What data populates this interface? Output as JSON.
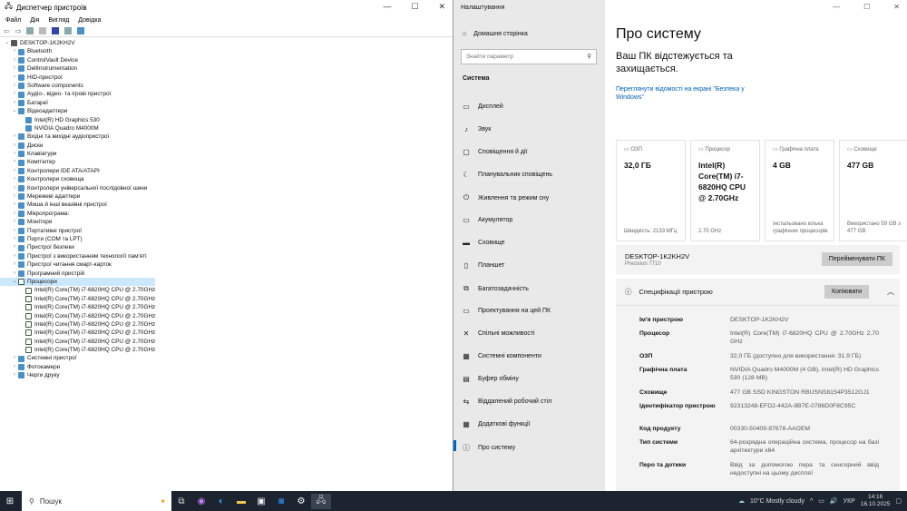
{
  "device_manager": {
    "title": "Диспетчер пристроїв",
    "menu": [
      "Файл",
      "Дія",
      "Вигляд",
      "Довідка"
    ],
    "root": "DESKTOP-1K2KH2V",
    "items": [
      {
        "label": "Bluetooth",
        "level": 1,
        "state": "collapsed"
      },
      {
        "label": "ControlVault Device",
        "level": 1,
        "state": "collapsed"
      },
      {
        "label": "DellInstrumentation",
        "level": 1,
        "state": "collapsed"
      },
      {
        "label": "HID-пристрої",
        "level": 1,
        "state": "collapsed"
      },
      {
        "label": "Software components",
        "level": 1,
        "state": "collapsed"
      },
      {
        "label": "Аудіо-, відео- та ігрові пристрої",
        "level": 1,
        "state": "collapsed"
      },
      {
        "label": "Батареї",
        "level": 1,
        "state": "collapsed"
      },
      {
        "label": "Відеоадаптери",
        "level": 1,
        "state": "expanded"
      },
      {
        "label": "Intel(R) HD Graphics 530",
        "level": 2,
        "state": "leaf"
      },
      {
        "label": "NVIDIA Quadro M4000M",
        "level": 2,
        "state": "leaf"
      },
      {
        "label": "Вхідні та вихідні аудіопристрої",
        "level": 1,
        "state": "collapsed"
      },
      {
        "label": "Диски",
        "level": 1,
        "state": "collapsed"
      },
      {
        "label": "Клавіатури",
        "level": 1,
        "state": "collapsed"
      },
      {
        "label": "Комп'ютер",
        "level": 1,
        "state": "collapsed"
      },
      {
        "label": "Контролери IDE ATA/ATAPI",
        "level": 1,
        "state": "collapsed"
      },
      {
        "label": "Контролери сховища",
        "level": 1,
        "state": "collapsed"
      },
      {
        "label": "Контролери універсальної послідовної шини",
        "level": 1,
        "state": "collapsed"
      },
      {
        "label": "Мережеві адаптери",
        "level": 1,
        "state": "collapsed"
      },
      {
        "label": "Миша й інші вказівні пристрої",
        "level": 1,
        "state": "collapsed"
      },
      {
        "label": "Мікропрограма:",
        "level": 1,
        "state": "collapsed"
      },
      {
        "label": "Монітори",
        "level": 1,
        "state": "collapsed"
      },
      {
        "label": "Портативні пристрої",
        "level": 1,
        "state": "collapsed"
      },
      {
        "label": "Порти (COM та LPT)",
        "level": 1,
        "state": "collapsed"
      },
      {
        "label": "Пристрої безпеки",
        "level": 1,
        "state": "collapsed"
      },
      {
        "label": "Пристрої з використанням технології пам'яті",
        "level": 1,
        "state": "collapsed"
      },
      {
        "label": "Пристрої читання смарт-карток",
        "level": 1,
        "state": "collapsed"
      },
      {
        "label": "Програмний пристрій",
        "level": 1,
        "state": "collapsed"
      },
      {
        "label": "Процесори",
        "level": 1,
        "state": "expanded",
        "selected": true
      },
      {
        "label": "Intel(R) Core(TM) i7-6820HQ CPU @ 2.70GHz",
        "level": 2,
        "state": "leaf",
        "cpu": true
      },
      {
        "label": "Intel(R) Core(TM) i7-6820HQ CPU @ 2.70GHz",
        "level": 2,
        "state": "leaf",
        "cpu": true
      },
      {
        "label": "Intel(R) Core(TM) i7-6820HQ CPU @ 2.70GHz",
        "level": 2,
        "state": "leaf",
        "cpu": true
      },
      {
        "label": "Intel(R) Core(TM) i7-6820HQ CPU @ 2.70GHz",
        "level": 2,
        "state": "leaf",
        "cpu": true
      },
      {
        "label": "Intel(R) Core(TM) i7-6820HQ CPU @ 2.70GHz",
        "level": 2,
        "state": "leaf",
        "cpu": true
      },
      {
        "label": "Intel(R) Core(TM) i7-6820HQ CPU @ 2.70GHz",
        "level": 2,
        "state": "leaf",
        "cpu": true
      },
      {
        "label": "Intel(R) Core(TM) i7-6820HQ CPU @ 2.70GHz",
        "level": 2,
        "state": "leaf",
        "cpu": true
      },
      {
        "label": "Intel(R) Core(TM) i7-6820HQ CPU @ 2.70GHz",
        "level": 2,
        "state": "leaf",
        "cpu": true
      },
      {
        "label": "Системні пристрої",
        "level": 1,
        "state": "collapsed"
      },
      {
        "label": "Фотокамери",
        "level": 1,
        "state": "collapsed"
      },
      {
        "label": "Черги друку",
        "level": 1,
        "state": "collapsed"
      }
    ]
  },
  "settings": {
    "title": "Налаштування",
    "home": "Домашня сторінка",
    "search_placeholder": "Знайти параметр",
    "section": "Система",
    "nav": [
      {
        "label": "Дисплей",
        "icon": "display-icon",
        "glyph": "▭"
      },
      {
        "label": "Звук",
        "icon": "sound-icon",
        "glyph": "♪"
      },
      {
        "label": "Сповіщення й дії",
        "icon": "notifications-icon",
        "glyph": "▢"
      },
      {
        "label": "Планувальник сповіщень",
        "icon": "moon-icon",
        "glyph": "☾"
      },
      {
        "label": "Живлення та режим сну",
        "icon": "power-icon",
        "glyph": "⏻"
      },
      {
        "label": "Акумулятор",
        "icon": "battery-icon",
        "glyph": "▭"
      },
      {
        "label": "Сховище",
        "icon": "storage-icon",
        "glyph": "▬"
      },
      {
        "label": "Планшет",
        "icon": "tablet-icon",
        "glyph": "▯"
      },
      {
        "label": "Багатозадачність",
        "icon": "multitasking-icon",
        "glyph": "⧉"
      },
      {
        "label": "Проектування на цей ПК",
        "icon": "projecting-icon",
        "glyph": "▭"
      },
      {
        "label": "Спільні можливості",
        "icon": "shared-icon",
        "glyph": "✕"
      },
      {
        "label": "Системні компоненти",
        "icon": "components-icon",
        "glyph": "▦"
      },
      {
        "label": "Буфер обміну",
        "icon": "clipboard-icon",
        "glyph": "▤"
      },
      {
        "label": "Віддалений робочий стіл",
        "icon": "remote-icon",
        "glyph": "⇆"
      },
      {
        "label": "Додаткові функції",
        "icon": "features-icon",
        "glyph": "▦"
      },
      {
        "label": "Про систему",
        "icon": "info-icon",
        "glyph": "ⓘ",
        "active": true
      }
    ],
    "page_title": "Про систему",
    "protected": "Ваш ПК відстежується та захищається.",
    "security_link": "Переглянути відомості на екрані \"Безпека у Windows\"",
    "cards": [
      {
        "label": "ОЗП",
        "value": "32,0 ГБ",
        "footer": "Швидкість: 2133 МГц"
      },
      {
        "label": "Процесор",
        "value": "Intel(R) Core(TM) i7-6820HQ CPU @ 2.70GHz",
        "footer": "2.70 GHz"
      },
      {
        "label": "Графічна плата",
        "value": "4 GB",
        "footer": "Інстальовано кілька графічних процесорів"
      },
      {
        "label": "Сховище",
        "value": "477 GB",
        "footer": "Використано 59 GB з 477 GB"
      }
    ],
    "device_name": "DESKTOP-1K2KH2V",
    "model": "Precision 7710",
    "rename_button": "Перейменувати ПК",
    "spec_title": "Специфікації пристрою",
    "copy_button": "Копіювати",
    "specs": [
      {
        "k": "Ім'я пристрою",
        "v": "DESKTOP-1K2KH2V"
      },
      {
        "k": "Процесор",
        "v": "Intel(R) Core(TM) i7-6820HQ CPU @ 2.70GHz 2.70 GHz"
      },
      {
        "k": "ОЗП",
        "v": "32,0 ГБ (доступно для використання: 31,9 ГБ)"
      },
      {
        "k": "Графічна плата",
        "v": "NVIDIA Quadro M4000M (4 GB), Intel(R) HD Graphics 530 (128 MB)"
      },
      {
        "k": "Сховище",
        "v": "477 GB SSD KINGSTON RBUSNS8154P3512GJ1"
      },
      {
        "k": "Ідентифікатор пристрою",
        "v": "92313248-EFD2-442A-9B7E-0786D0F8C95C"
      },
      {
        "k": "Код продукту",
        "v": "00330-50409-87678-AAOEM"
      },
      {
        "k": "Тип системи",
        "v": "64-розрядна операційна система, процесор на базі архітектури x64"
      },
      {
        "k": "Перо та дотики",
        "v": "Ввід за допомогою пера та сенсорний ввід недоступні на цьому дисплеї"
      }
    ]
  },
  "taskbar": {
    "search": "Пошук",
    "weather": "10°C  Mostly cloudy",
    "lang": "УКР",
    "time": "14:16",
    "date": "16.10.2025"
  }
}
